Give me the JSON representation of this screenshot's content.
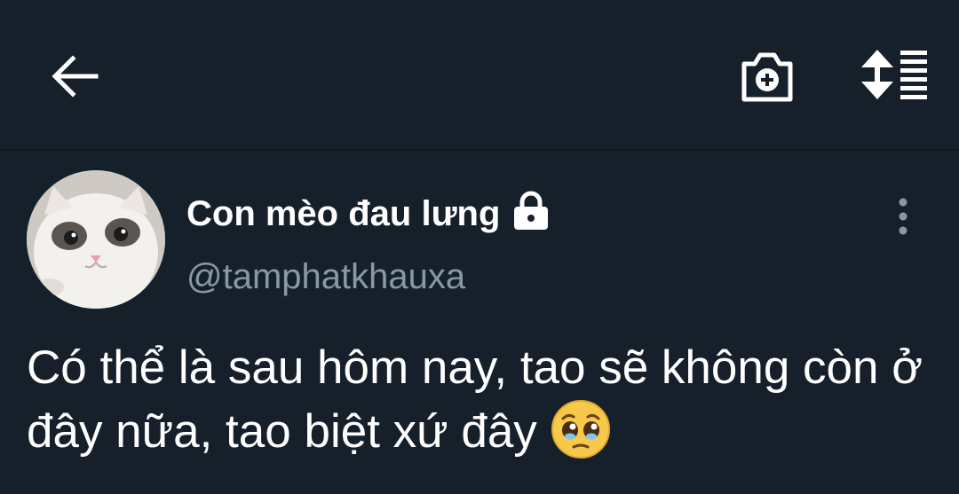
{
  "header": {
    "back_icon": "arrow-left-icon",
    "camera_icon": "camera-plus-icon",
    "sort_icon": "sort-lines-icon"
  },
  "tweet": {
    "display_name": "Con mèo đau lưng",
    "handle": "@tamphatkhauxa",
    "text": "Có thể là sau hôm nay, tao sẽ không còn ở đây nữa, tao biệt xứ đây",
    "emoji": "pleading-face-emoji",
    "protected": true,
    "more_icon": "more-vertical-icon"
  },
  "colors": {
    "background": "#15202b",
    "text": "#ffffff",
    "secondary_text": "#8899a6"
  }
}
